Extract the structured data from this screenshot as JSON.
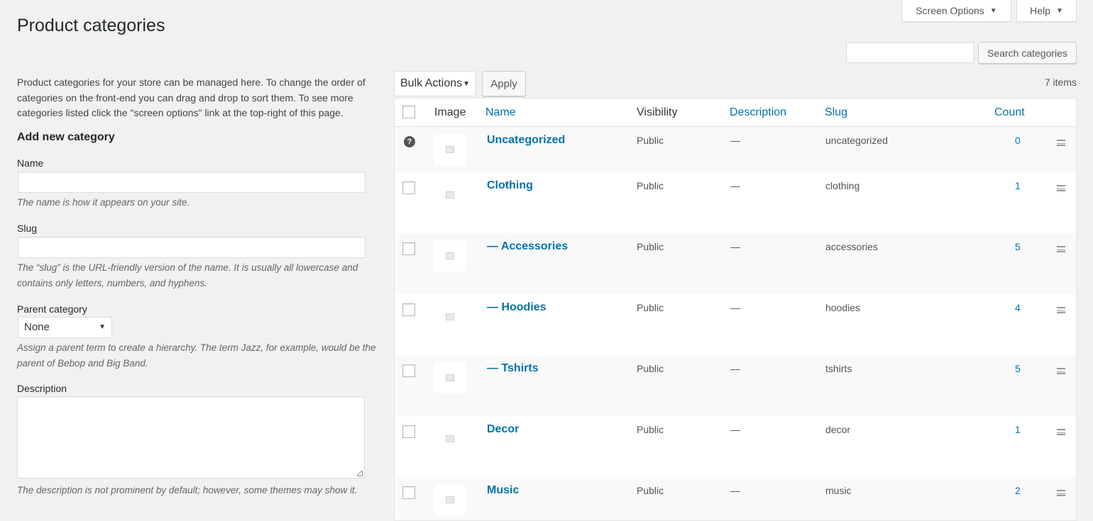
{
  "header": {
    "title": "Product categories",
    "screen_options_label": "Screen Options",
    "help_label": "Help"
  },
  "search": {
    "value": "",
    "button_label": "Search categories"
  },
  "form": {
    "intro": "Product categories for your store can be managed here. To change the order of categories on the front-end you can drag and drop to sort them. To see more categories listed click the \"screen options\" link at the top-right of this page.",
    "section_title": "Add new category",
    "name_label": "Name",
    "name_hint": "The name is how it appears on your site.",
    "slug_label": "Slug",
    "slug_hint": "The “slug” is the URL-friendly version of the name. It is usually all lowercase and contains only letters, numbers, and hyphens.",
    "parent_label": "Parent category",
    "parent_value": "None",
    "parent_hint": "Assign a parent term to create a hierarchy. The term Jazz, for example, would be the parent of Bebop and Big Band.",
    "description_label": "Description",
    "description_hint": "The description is not prominent by default; however, some themes may show it."
  },
  "toolbar": {
    "bulk_actions_label": "Bulk Actions",
    "apply_label": "Apply",
    "items_count": "7 items"
  },
  "table": {
    "columns": {
      "image": "Image",
      "name": "Name",
      "visibility": "Visibility",
      "description": "Description",
      "slug": "Slug",
      "count": "Count"
    },
    "rows": [
      {
        "name": "Uncategorized",
        "visibility": "Public",
        "description": "—",
        "slug": "uncategorized",
        "count": "0"
      },
      {
        "name": "Clothing",
        "visibility": "Public",
        "description": "—",
        "slug": "clothing",
        "count": "1"
      },
      {
        "name": "— Accessories",
        "visibility": "Public",
        "description": "—",
        "slug": "accessories",
        "count": "5"
      },
      {
        "name": "— Hoodies",
        "visibility": "Public",
        "description": "—",
        "slug": "hoodies",
        "count": "4"
      },
      {
        "name": "— Tshirts",
        "visibility": "Public",
        "description": "—",
        "slug": "tshirts",
        "count": "5"
      },
      {
        "name": "Decor",
        "visibility": "Public",
        "description": "—",
        "slug": "decor",
        "count": "1"
      },
      {
        "name": "Music",
        "visibility": "Public",
        "description": "—",
        "slug": "music",
        "count": "2"
      }
    ]
  },
  "icons": {
    "dropdown": "caret-down-icon",
    "default_category": "question-circle-icon",
    "drag": "drag-handle-icon",
    "placeholder": "image-placeholder-icon"
  }
}
